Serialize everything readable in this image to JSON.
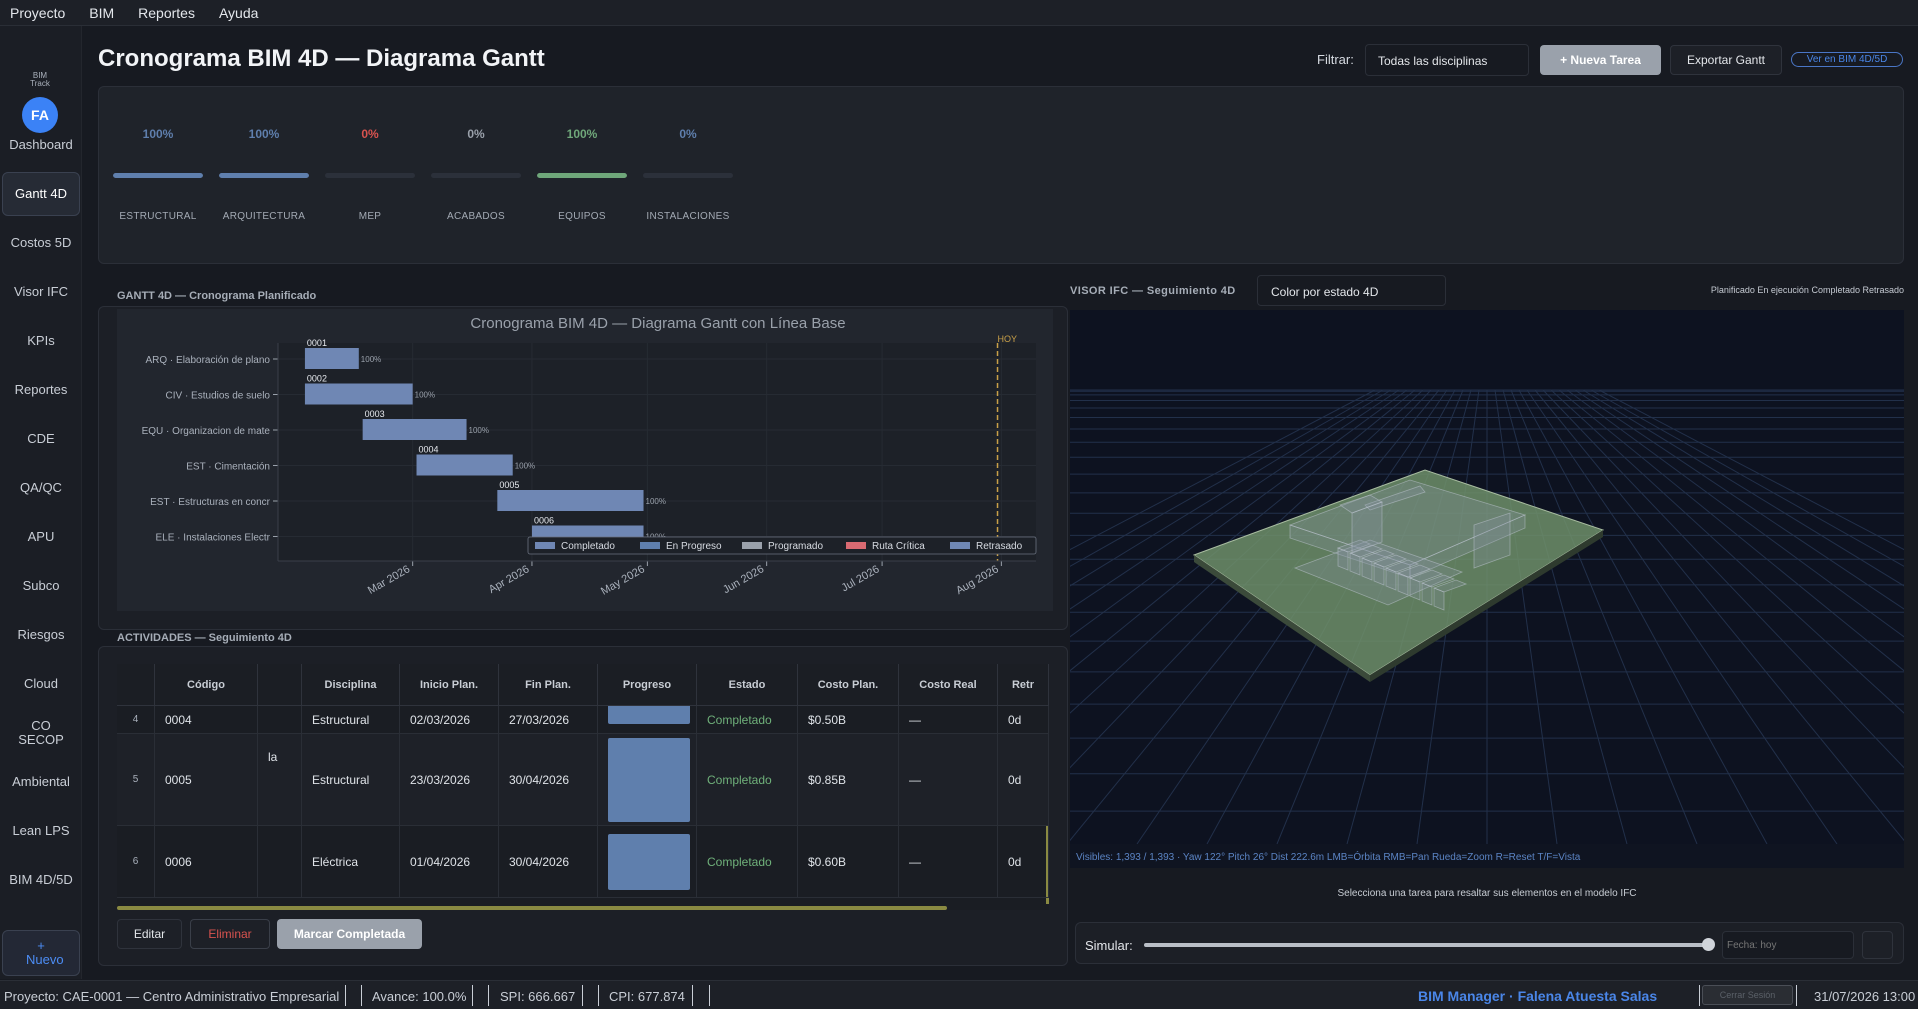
{
  "menu": [
    "Proyecto",
    "BIM",
    "Reportes",
    "Ayuda"
  ],
  "sidebar": {
    "logo_text": "BIM Track",
    "avatar": "FA",
    "items": [
      {
        "label": "Dashboard"
      },
      {
        "label": "Gantt 4D",
        "active": true
      },
      {
        "label": "Costos 5D"
      },
      {
        "label": "Visor IFC"
      },
      {
        "label": "KPIs"
      },
      {
        "label": "Reportes"
      },
      {
        "label": "CDE"
      },
      {
        "label": "QA/QC"
      },
      {
        "label": "APU"
      },
      {
        "label": "Subco"
      },
      {
        "label": "Riesgos"
      },
      {
        "label": "Cloud"
      },
      {
        "label": "CO SECOP"
      },
      {
        "label": "Ambiental"
      },
      {
        "label": "Lean LPS"
      },
      {
        "label": "BIM 4D/5D"
      }
    ],
    "new_label": "+ Nuevo"
  },
  "header": {
    "title": "Cronograma BIM 4D — Diagrama Gantt",
    "filter_label": "Filtrar:",
    "filter_value": "Todas las disciplinas",
    "new_task": "+ Nueva Tarea",
    "export": "Exportar Gantt",
    "view_4d": "Ver en BIM 4D/5D"
  },
  "progress": [
    {
      "label": "ESTRUCTURAL",
      "pct": "100%",
      "fill": 1.0,
      "color": "#5f7fad"
    },
    {
      "label": "ARQUITECTURA",
      "pct": "100%",
      "fill": 1.0,
      "color": "#5f7fad"
    },
    {
      "label": "MEP",
      "pct": "0%",
      "fill": 0,
      "color": "#d9534f"
    },
    {
      "label": "ACABADOS",
      "pct": "0%",
      "fill": 0,
      "color": "#9aa1ab"
    },
    {
      "label": "EQUIPOS",
      "pct": "100%",
      "fill": 1.0,
      "color": "#6fa77a"
    },
    {
      "label": "INSTALACIONES",
      "pct": "0%",
      "fill": 0,
      "color": "#5f7fad"
    }
  ],
  "gantt_section": "GANTT 4D — Cronograma Planificado",
  "chart_data": {
    "type": "bar",
    "title": "Cronograma BIM 4D — Diagrama Gantt con Línea Base",
    "today_label": "HOY",
    "today": "2026-07-31",
    "x_ticks": [
      "Mar 2026",
      "Apr 2026",
      "May 2026",
      "Jun 2026",
      "Jul 2026",
      "Aug 2026"
    ],
    "tasks": [
      {
        "label": "ARQ · Elaboración de plano",
        "code": "0001",
        "start": "2026-02-01",
        "end": "2026-02-15",
        "pct": "100%"
      },
      {
        "label": "CIV · Estudios de suelo",
        "code": "0002",
        "start": "2026-02-01",
        "end": "2026-03-01",
        "pct": "100%"
      },
      {
        "label": "EQU · Organizacion de mate",
        "code": "0003",
        "start": "2026-02-16",
        "end": "2026-03-15",
        "pct": "100%"
      },
      {
        "label": "EST · Cimentación",
        "code": "0004",
        "start": "2026-03-02",
        "end": "2026-03-27",
        "pct": "100%"
      },
      {
        "label": "EST · Estructuras en concr",
        "code": "0005",
        "start": "2026-03-23",
        "end": "2026-04-30",
        "pct": "100%"
      },
      {
        "label": "ELE · Instalaciones Electr",
        "code": "0006",
        "start": "2026-04-01",
        "end": "2026-04-30",
        "pct": "100%"
      }
    ],
    "legend": [
      "Completado",
      "En Progreso",
      "Programado",
      "Ruta Crítica",
      "Retrasado"
    ],
    "colors": {
      "completado": "#6f87b4",
      "en_progreso": "#5f7fad",
      "programado": "#9aa1ab",
      "critica": "#d96a72",
      "retrasado": "#6f87b4",
      "hoy": "#c9a048"
    }
  },
  "activities": {
    "section": "ACTIVIDADES — Seguimiento 4D",
    "columns": [
      "",
      "Código",
      "",
      "Disciplina",
      "Inicio Plan.",
      "Fin Plan.",
      "Progreso",
      "Estado",
      "Costo Plan.",
      "Costo Real",
      "Retr"
    ],
    "rows": [
      {
        "n": "4",
        "code": "0004",
        "name": "",
        "disc": "Estructural",
        "start": "02/03/2026",
        "end": "27/03/2026",
        "status": "Completado",
        "cost": "$0.50B",
        "real": "—",
        "delay": "0d"
      },
      {
        "n": "5",
        "code": "0005",
        "name": "la",
        "disc": "Estructural",
        "start": "23/03/2026",
        "end": "30/04/2026",
        "status": "Completado",
        "cost": "$0.85B",
        "real": "—",
        "delay": "0d"
      },
      {
        "n": "6",
        "code": "0006",
        "name": "",
        "disc": "Eléctrica",
        "start": "01/04/2026",
        "end": "30/04/2026",
        "status": "Completado",
        "cost": "$0.60B",
        "real": "—",
        "delay": "0d"
      }
    ],
    "edit": "Editar",
    "delete": "Eliminar",
    "mark_done": "Marcar Completada"
  },
  "ifc": {
    "title": "VISOR IFC — Seguimiento 4D",
    "color_mode": "Color por estado 4D",
    "legend": "Planificado En ejecución Completado Retrasado",
    "status": "Visibles: 1,393 / 1,393 · Yaw 122° Pitch 26° Dist 222.6m  LMB=Órbita RMB=Pan Rueda=Zoom R=Reset T/F=Vista",
    "hint": "Selecciona una tarea para resaltar sus elementos en el modelo IFC",
    "sim_label": "Simular:",
    "sim_value": 0.985,
    "date_placeholder": "Fecha: hoy"
  },
  "statusbar": {
    "project": "Proyecto: CAE-0001 — Centro Administrativo Empresarial",
    "avance": "Avance: 100.0%",
    "spi": "SPI: 666.667",
    "cpi": "CPI: 677.874",
    "user": "BIM Manager · Falena Atuesta Salas",
    "logout": "Cerrar Sesión",
    "datetime": "31/07/2026 13:00"
  }
}
